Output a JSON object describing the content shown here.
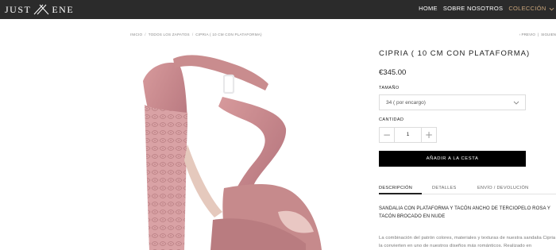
{
  "brand": {
    "left": "JUST",
    "right": "ENE"
  },
  "nav": {
    "items": [
      {
        "label": "HOME"
      },
      {
        "label": "SOBRE NOSOTROS"
      },
      {
        "label": "COLECCIÓN"
      }
    ]
  },
  "breadcrumb": {
    "items": [
      "INICIO",
      "TODOS LOS ZAPATOS",
      "CIPRIA ( 10 CM CON PLATAFORMA)"
    ]
  },
  "pager": {
    "prev": "PREVIO",
    "next": "SIGUIEN"
  },
  "product": {
    "title": "CIPRIA ( 10 CM CON PLATAFORMA)",
    "price": "€345.00",
    "size_label": "TAMAÑO",
    "size_value": "34 ( por encargo)",
    "qty_label": "CANTIDAD",
    "qty_value": "1",
    "qty_minus": "−",
    "qty_plus": "+",
    "add_to_cart": "AÑADIR A LA CESTA"
  },
  "tabs": [
    {
      "label": "DESCRIPCIÓN"
    },
    {
      "label": "DETALLES"
    },
    {
      "label": "ENVÍO / DEVOLUCIÓN"
    }
  ],
  "description": {
    "heading": "SANDALIA CON PLATAFORMA Y TACÓN ANCHO DE TERCIOPELO ROSA Y TACÓN BROCADO EN NUDE",
    "body": "La combinación del patrón colores, materiales y texturas de nuestra sandalia Cipria la convierten en uno de nuestros diseños más románticos. Realizado en"
  },
  "colors": {
    "topbar": "#2b2b2b",
    "accent": "#c9a57a",
    "shoe": "#c98c8e",
    "button": "#000000"
  }
}
